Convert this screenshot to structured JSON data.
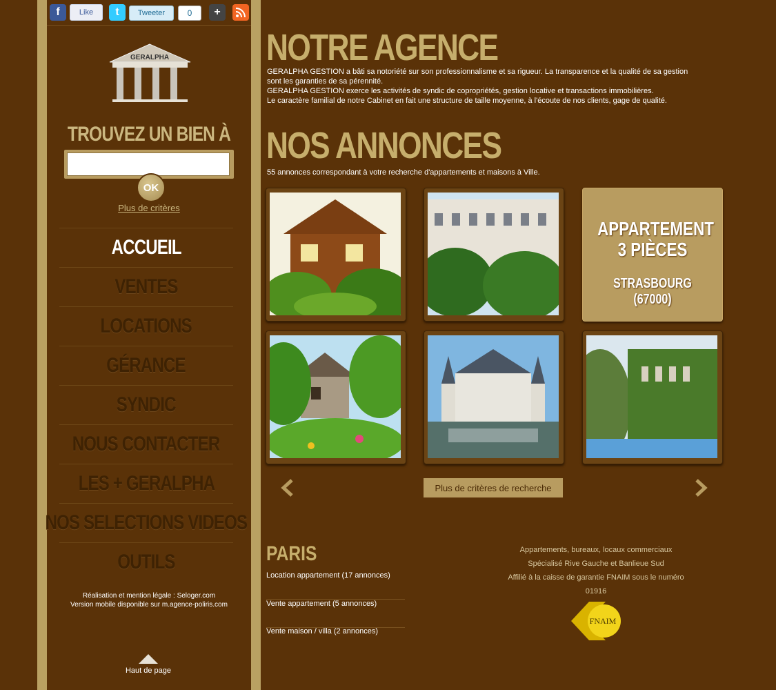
{
  "social": {
    "facebook_icon": "f",
    "like_label": "Like",
    "twitter_icon": "t",
    "tweet_label": "Tweeter",
    "tweet_count": "0",
    "plus_icon": "+",
    "rss_icon": "rss"
  },
  "logo": {
    "text": "GERALPHA"
  },
  "search": {
    "title": "TROUVEZ UN BIEN À",
    "input_value": "",
    "ok_label": "OK",
    "more_criteria": "Plus de critères"
  },
  "nav": {
    "items": [
      "ACCUEIL",
      "VENTES",
      "LOCATIONS",
      "GÉRANCE",
      "SYNDIC",
      "NOUS CONTACTER",
      "LES + GERALPHA",
      "NOS SELECTIONS VIDEOS",
      "OUTILS"
    ]
  },
  "credits": {
    "line1": "Réalisation et mention légale : Seloger.com",
    "line2": "Version mobile disponible sur m.agence-poliris.com"
  },
  "top_link": "Haut de page",
  "agency": {
    "title": "NOTRE AGENCE",
    "p1": "GERALPHA GESTION a bâti sa notoriété sur son professionnalisme et sa rigueur. La transparence et la qualité de sa gestion sont les garanties de sa pérennité.",
    "p2": "GERALPHA GESTION exerce les activités de syndic de copropriétés, gestion locative et transactions immobilières.",
    "p3": "Le caractère familial de notre Cabinet en fait une structure de taille moyenne, à l'écoute de nos clients, gage de qualité."
  },
  "listings": {
    "title": "NOS ANNONCES",
    "summary": "55 annonces correspondant à votre recherche d'appartements et maisons à Ville.",
    "highlight": {
      "title_line1": "APPARTEMENT",
      "title_line2": "3 PIÈCES",
      "city": "STRASBOURG (67000)"
    },
    "more_button": "Plus de critères de recherche"
  },
  "paris": {
    "title": "PARIS",
    "links": [
      "Location appartement (17 annonces)",
      "Vente appartement (5 annonces)",
      "Vente maison / villa (2 annonces)"
    ]
  },
  "footer": {
    "line1": "Appartements, bureaux, locaux commerciaux",
    "line2": "Spécialisé Rive Gauche et Banlieue Sud",
    "line3": "Affilié à la caisse de garantie FNAIM sous le numéro",
    "line4": "01916",
    "fnaim_label": "FNAIM"
  }
}
